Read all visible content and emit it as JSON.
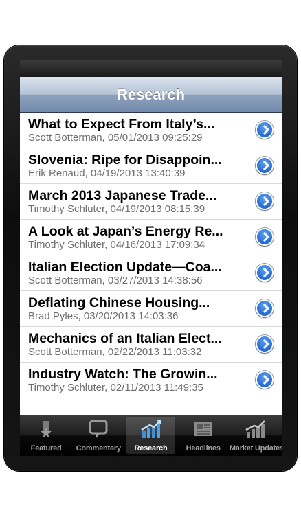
{
  "navbar": {
    "title": "Research"
  },
  "articles": [
    {
      "title": "What to Expect From Italy’s...",
      "byline": "Scott Botterman, 05/01/2013 09:25:29"
    },
    {
      "title": "Slovenia: Ripe for Disappoin...",
      "byline": "Erik Renaud, 04/19/2013 13:40:39"
    },
    {
      "title": "March 2013 Japanese Trade...",
      "byline": "Timothy Schluter, 04/19/2013 08:15:39"
    },
    {
      "title": "A Look at Japan’s Energy Re...",
      "byline": "Timothy Schluter, 04/16/2013 17:09:34"
    },
    {
      "title": "Italian Election Update—Coa...",
      "byline": "Scott Botterman, 03/27/2013 14:38:56"
    },
    {
      "title": "Deflating Chinese Housing...",
      "byline": "Brad Pyles, 03/20/2013 14:03:36"
    },
    {
      "title": "Mechanics of an Italian Elect...",
      "byline": "Scott Botterman, 02/22/2013 11:03:32"
    },
    {
      "title": "Industry Watch: The Growin...",
      "byline": "Timothy Schluter, 02/11/2013 11:49:35"
    }
  ],
  "tabs": [
    {
      "label": "Featured",
      "icon": "star-icon"
    },
    {
      "label": "Commentary",
      "icon": "speech-bubble-icon"
    },
    {
      "label": "Research",
      "icon": "bar-chart-icon"
    },
    {
      "label": "Headlines",
      "icon": "newspaper-icon"
    },
    {
      "label": "Market Updates",
      "icon": "trend-chart-icon"
    }
  ],
  "active_tab": "Research",
  "colors": {
    "navbar_top": "#dbe3ee",
    "navbar_bottom": "#7189ab",
    "disclosure_blue": "#2a6fd6",
    "active_tab_accent": "#4aa3e8"
  }
}
